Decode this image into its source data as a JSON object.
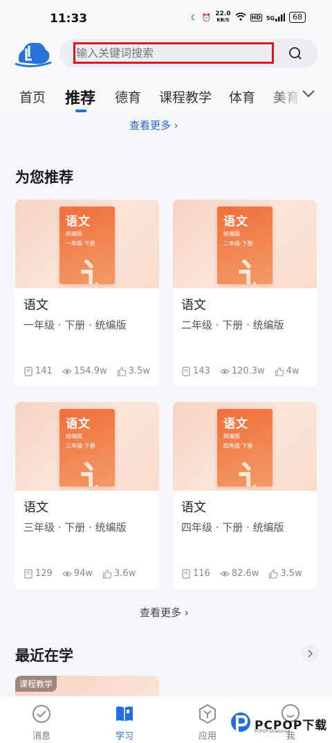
{
  "status_bar": {
    "time": "11:33",
    "net_speed_value": "22.0",
    "net_speed_unit": "KB/S",
    "hd": "HD",
    "signal": "5G",
    "battery": "68"
  },
  "search": {
    "placeholder": "输入关键词搜索"
  },
  "tabs": [
    {
      "label": "首页"
    },
    {
      "label": "推荐"
    },
    {
      "label": "德育"
    },
    {
      "label": "课程教学"
    },
    {
      "label": "体育"
    },
    {
      "label": "美育"
    }
  ],
  "top_more": "查看更多 ›",
  "recommend": {
    "title": "为您推荐",
    "cards": [
      {
        "subject": "语文",
        "meta": "一年级 · 下册 · 统编版",
        "book_title": "语文",
        "book_edition": "统编版",
        "book_grade": "一年级·下册",
        "pages": "141",
        "views": "154.9w",
        "likes": "3.5w"
      },
      {
        "subject": "语文",
        "meta": "二年级 · 下册 · 统编版",
        "book_title": "语文",
        "book_edition": "统编版",
        "book_grade": "二年级·下册",
        "pages": "143",
        "views": "120.3w",
        "likes": "4w"
      },
      {
        "subject": "语文",
        "meta": "三年级 · 下册 · 统编版",
        "book_title": "语文",
        "book_edition": "统编版",
        "book_grade": "三年级·下册",
        "pages": "129",
        "views": "94w",
        "likes": "3.6w"
      },
      {
        "subject": "语文",
        "meta": "四年级 · 下册 · 统编版",
        "book_title": "语文",
        "book_edition": "统编版",
        "book_grade": "四年级·下册",
        "pages": "116",
        "views": "82.6w",
        "likes": "3.5w"
      }
    ],
    "more": "查看更多 ›"
  },
  "recent": {
    "title": "最近在学",
    "tag": "课程教学"
  },
  "bottom_nav": [
    {
      "label": "消息",
      "icon": "message-icon"
    },
    {
      "label": "学习",
      "icon": "study-book-icon"
    },
    {
      "label": "应用",
      "icon": "apps-icon"
    },
    {
      "label": "我",
      "icon": "profile-icon"
    }
  ],
  "watermark": {
    "text": "PCPOP下载",
    "sub": "PCPOP Download"
  },
  "colors": {
    "accent": "#1e6fe8",
    "highlight_box": "#e0151b",
    "book_orange": "#f06f3a"
  }
}
